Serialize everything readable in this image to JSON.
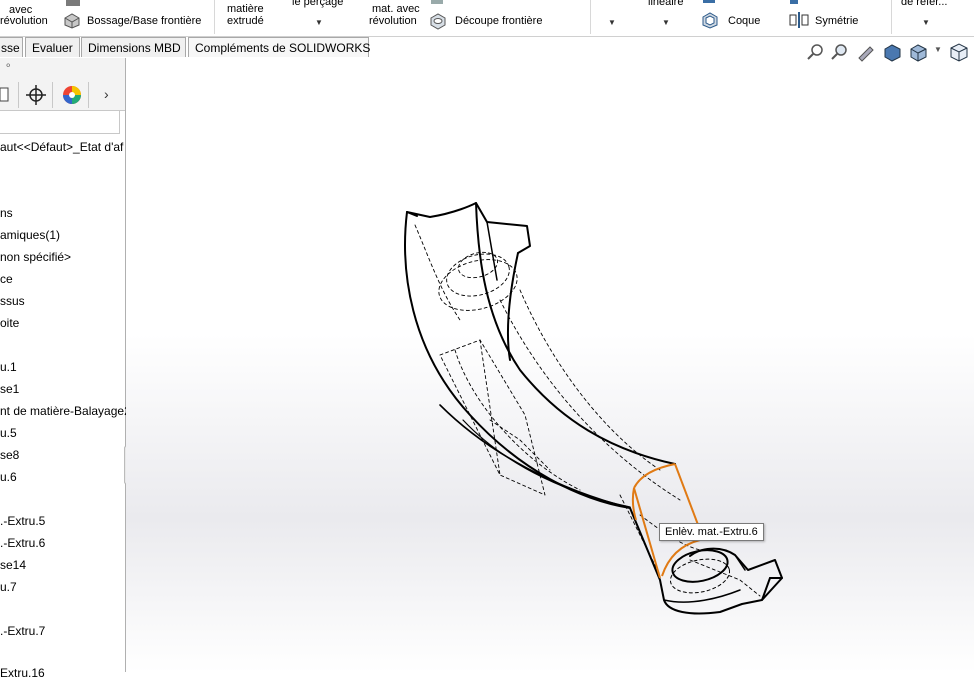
{
  "toolbar": {
    "revolve_line1": "avec",
    "revolve_line2": "révolution",
    "loft_boss": "Bossage/Base frontière",
    "extrude_cut_line1": "matière",
    "extrude_cut_line2": "extrudé",
    "hole_wizard": "le perçage",
    "revolve_cut_line1": "mat. avec",
    "revolve_cut_line2": "révolution",
    "loft_cut": "Découpe frontière",
    "linear_pattern": "linéaire",
    "shell": "Coque",
    "mirror": "Symétrie",
    "ref_geometry": "de référ..."
  },
  "tabs": [
    "sse",
    "Evaluer",
    "Dimensions MBD",
    "Compléments de SOLIDWORKS"
  ],
  "feature_tree": [
    "aut<<Défaut>_Etat d'af",
    "ns",
    "amiques(1)",
    "non spécifié>",
    "ce",
    "ssus",
    "oite",
    "u.1",
    "se1",
    "nt de matière-Balayage2",
    "u.5",
    "se8",
    "u.6",
    ".-Extru.5",
    ".-Extru.6",
    "se14",
    "u.7",
    ".-Extru.7",
    "Extru.16"
  ],
  "tooltip": "Enlèv. mat.-Extru.6",
  "colors": {
    "highlight": "#e07a14",
    "edge": "#000000"
  }
}
